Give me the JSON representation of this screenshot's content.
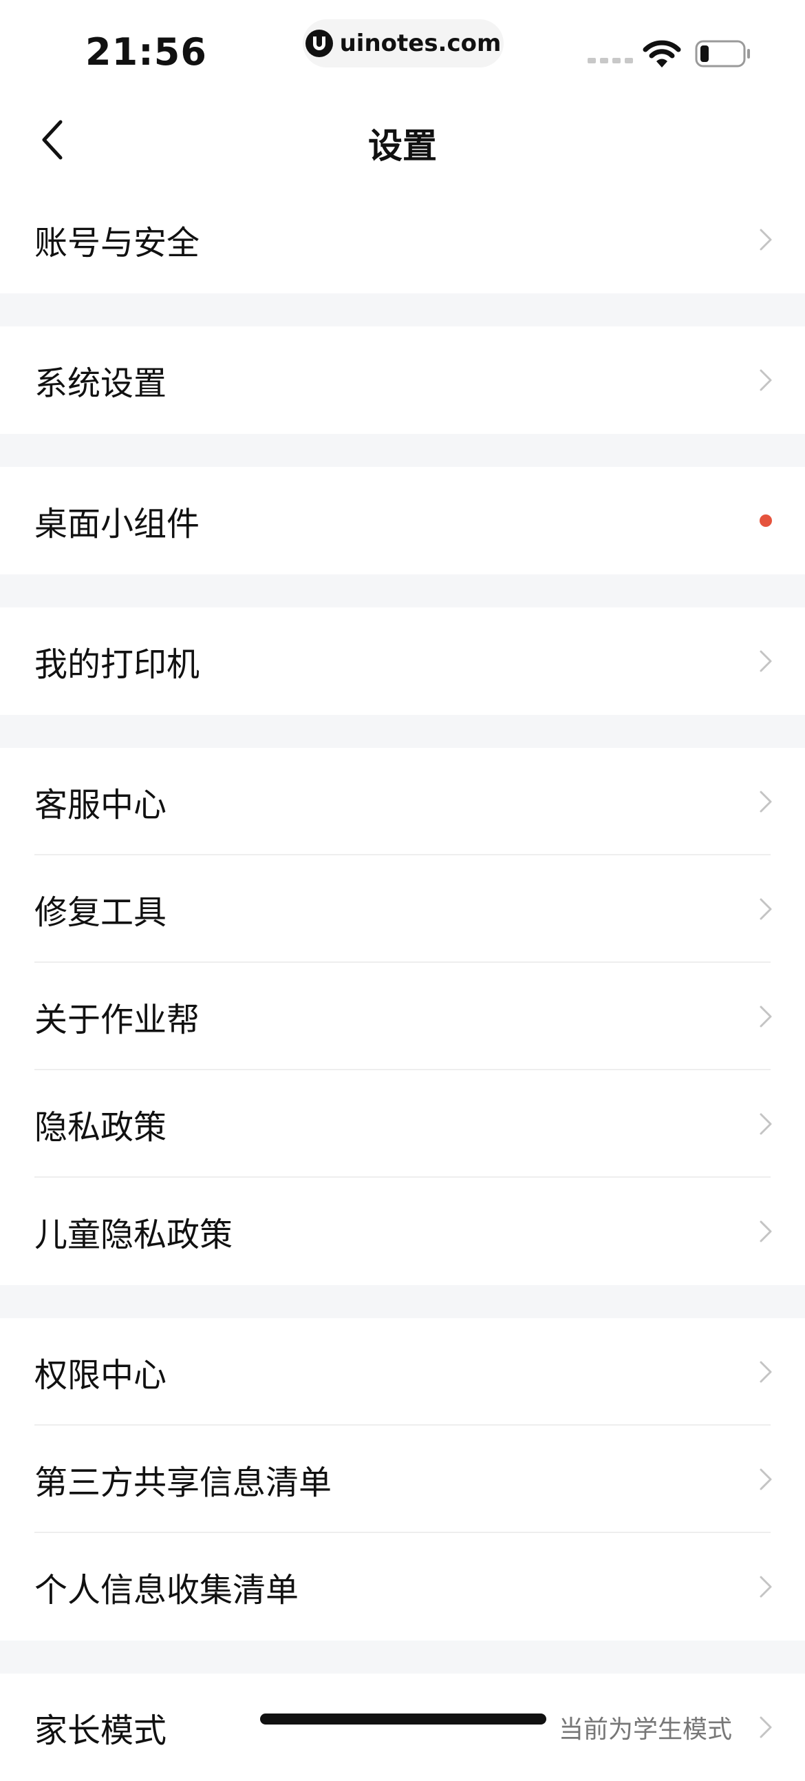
{
  "status_bar": {
    "time": "21:56",
    "url": "uinotes.com",
    "icons": [
      "signal-dots-icon",
      "wifi-icon",
      "battery-icon"
    ]
  },
  "nav": {
    "title": "设置",
    "back_icon": "chevron-left-icon"
  },
  "groups": [
    {
      "items": [
        {
          "label": "账号与安全",
          "accessory": "chevron"
        }
      ]
    },
    {
      "items": [
        {
          "label": "系统设置",
          "accessory": "chevron"
        }
      ]
    },
    {
      "items": [
        {
          "label": "桌面小组件",
          "accessory": "red-dot"
        }
      ]
    },
    {
      "items": [
        {
          "label": "我的打印机",
          "accessory": "chevron"
        }
      ]
    },
    {
      "items": [
        {
          "label": "客服中心",
          "accessory": "chevron"
        },
        {
          "label": "修复工具",
          "accessory": "chevron"
        },
        {
          "label": "关于作业帮",
          "accessory": "chevron"
        },
        {
          "label": "隐私政策",
          "accessory": "chevron"
        },
        {
          "label": "儿童隐私政策",
          "accessory": "chevron"
        }
      ]
    },
    {
      "items": [
        {
          "label": "权限中心",
          "accessory": "chevron"
        },
        {
          "label": "第三方共享信息清单",
          "accessory": "chevron"
        },
        {
          "label": "个人信息收集清单",
          "accessory": "chevron"
        }
      ]
    },
    {
      "items": [
        {
          "label": "家长模式",
          "value": "当前为学生模式",
          "accessory": "chevron"
        }
      ]
    }
  ],
  "colors": {
    "background": "#ffffff",
    "group_gap": "#f5f6f8",
    "separator": "#eeeeee",
    "chevron": "#c4c4c4",
    "badge_dot": "#e5533d",
    "secondary_text": "#777777"
  }
}
